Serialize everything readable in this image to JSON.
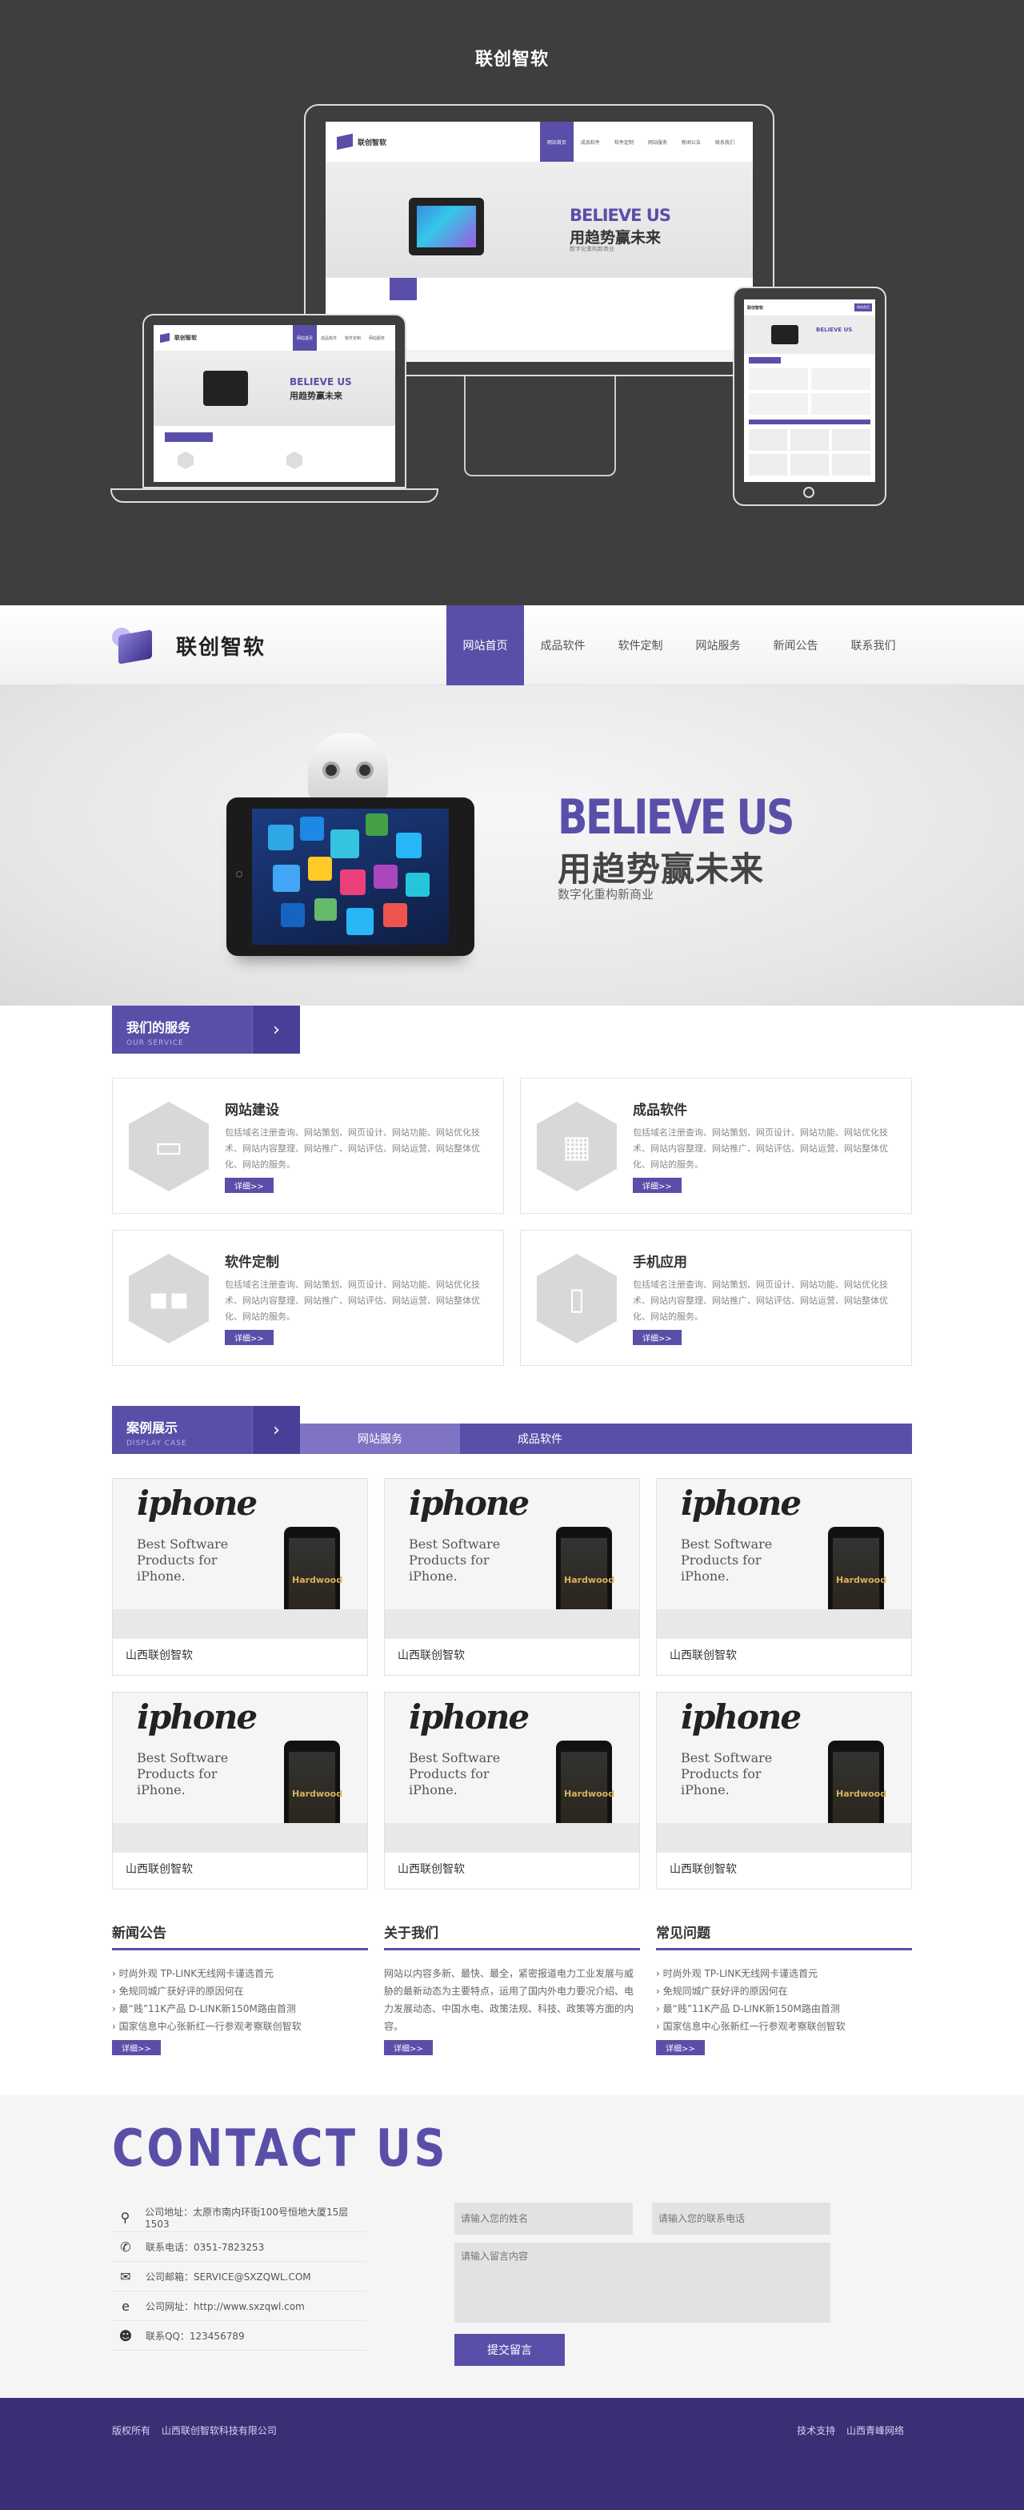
{
  "showcase": {
    "title": "联创智软"
  },
  "brand": {
    "name": "联创智软"
  },
  "nav": [
    {
      "label": "网站首页"
    },
    {
      "label": "成品软件"
    },
    {
      "label": "软件定制"
    },
    {
      "label": "网站服务"
    },
    {
      "label": "新闻公告"
    },
    {
      "label": "联系我们"
    }
  ],
  "banner": {
    "headline": "BELIEVE US",
    "subhead": "用趋势赢未来",
    "tagline": "数字化重构新商业"
  },
  "services": {
    "title": "我们的服务",
    "subtitle": "OUR SERVICE",
    "items": [
      {
        "title": "网站建设",
        "icon": "monitor-icon",
        "desc": "包括域名注册查询、网站策划、网页设计、网站功能、网站优化技术、网站内容整理、网站推广、网站评估、网站运营、网站整体优化、网站的服务。",
        "more": "详细>>"
      },
      {
        "title": "成品软件",
        "icon": "layout-icon",
        "desc": "包括域名注册查询、网站策划、网页设计、网站功能、网站优化技术、网站内容整理、网站推广、网站评估、网站运营、网站整体优化、网站的服务。",
        "more": "详细>>"
      },
      {
        "title": "软件定制",
        "icon": "grid-icon",
        "desc": "包括域名注册查询、网站策划、网页设计、网站功能、网站优化技术、网站内容整理、网站推广、网站评估、网站运营、网站整体优化、网站的服务。",
        "more": "详细>>"
      },
      {
        "title": "手机应用",
        "icon": "phone-icon",
        "desc": "包括域名注册查询、网站策划、网页设计、网站功能、网站优化技术、网站内容整理、网站推广、网站评估、网站运营、网站整体优化、网站的服务。",
        "more": "详细>>"
      }
    ]
  },
  "cases": {
    "title": "案例展示",
    "subtitle": "DISPLAY CASE",
    "tabs": [
      {
        "label": "网站服务"
      },
      {
        "label": "成品软件"
      }
    ],
    "items": [
      {
        "caption": "山西联创智软",
        "brand": "iphone",
        "headline": "Best Software Products for iPhone.",
        "phone_text": "Hardwood"
      },
      {
        "caption": "山西联创智软",
        "brand": "iphone",
        "headline": "Best Software Products for iPhone.",
        "phone_text": "Hardwood"
      },
      {
        "caption": "山西联创智软",
        "brand": "iphone",
        "headline": "Best Software Products for iPhone.",
        "phone_text": "Hardwood"
      },
      {
        "caption": "山西联创智软",
        "brand": "iphone",
        "headline": "Best Software Products for iPhone.",
        "phone_text": "Hardwood"
      },
      {
        "caption": "山西联创智软",
        "brand": "iphone",
        "headline": "Best Software Products for iPhone.",
        "phone_text": "Hardwood"
      },
      {
        "caption": "山西联创智软",
        "brand": "iphone",
        "headline": "Best Software Products for iPhone.",
        "phone_text": "Hardwood"
      }
    ]
  },
  "news": {
    "title": "新闻公告",
    "items": [
      "时尚外观 TP-LINK无线网卡谨选首元",
      "免规同城广获好评的原因何在",
      "最“贱”11K产品 D-LINK新150M路由首测",
      "国家信息中心张新红一行参观考察联创智软"
    ],
    "more": "详细>>"
  },
  "about": {
    "title": "关于我们",
    "text": "网站以内容多新、最快、最全，紧密报道电力工业发展与威胁的最新动态为主要特点，运用了国内外电力要况介绍、电力发展动态、中国水电、政策法规、科技、政策等方面的内容。",
    "more": "详细>>"
  },
  "faq": {
    "title": "常见问题",
    "items": [
      "时尚外观 TP-LINK无线网卡谨选首元",
      "免规同城广获好评的原因何在",
      "最“贱”11K产品 D-LINK新150M路由首测",
      "国家信息中心张新红一行参观考察联创智软"
    ],
    "more": "详细>>"
  },
  "contact": {
    "title": "CONTACT US",
    "lines": [
      {
        "icon": "map-pin-icon",
        "text": "公司地址：太原市南内环街100号恒地大厦15层1503"
      },
      {
        "icon": "phone-icon",
        "text": "联系电话：0351-7823253"
      },
      {
        "icon": "mail-icon",
        "text": "公司邮箱：SERVICE@SXZQWL.COM"
      },
      {
        "icon": "globe-icon",
        "text": "公司网址：http://www.sxzqwl.com"
      },
      {
        "icon": "qq-icon",
        "text": "联系QQ：123456789"
      }
    ],
    "form": {
      "name_placeholder": "请输入您的姓名",
      "phone_placeholder": "请输入您的联系电话",
      "message_placeholder": "请输入留言内容",
      "submit": "提交留言"
    }
  },
  "footer": {
    "copyright": "版权所有",
    "company": "山西联创智软科技有限公司",
    "tech": "技术支持",
    "tech_company": "山西青峰网络"
  },
  "mini": {
    "nav": [
      "网站首页",
      "成品软件",
      "软件定制",
      "网站服务",
      "新闻公告",
      "联系我们"
    ]
  }
}
